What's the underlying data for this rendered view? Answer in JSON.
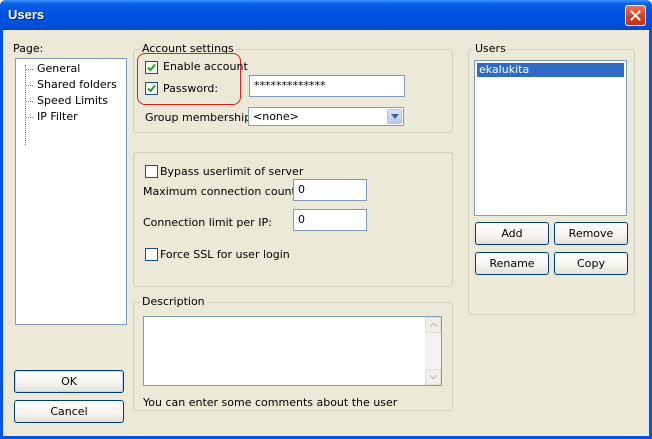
{
  "window": {
    "title": "Users",
    "close_icon": "close-icon"
  },
  "page_panel": {
    "label": "Page:",
    "items": [
      "General",
      "Shared folders",
      "Speed Limits",
      "IP Filter"
    ]
  },
  "account_settings": {
    "title": "Account settings",
    "enable_account": {
      "label": "Enable account",
      "checked": true
    },
    "password": {
      "label": "Password:",
      "checked": true,
      "value": "*************"
    },
    "group_membership": {
      "label": "Group membership:",
      "value": "<none>"
    }
  },
  "limits": {
    "bypass": {
      "label": "Bypass userlimit of server",
      "checked": false
    },
    "max_conn": {
      "label": "Maximum connection count:",
      "value": "0"
    },
    "conn_per_ip": {
      "label": "Connection limit per IP:",
      "value": "0"
    },
    "force_ssl": {
      "label": "Force SSL for user login",
      "checked": false
    }
  },
  "description": {
    "title": "Description",
    "value": "",
    "hint": "You can enter some comments about the user"
  },
  "users_panel": {
    "title": "Users",
    "items": [
      "ekalukita"
    ],
    "selected": "ekalukita",
    "add_label": "Add",
    "remove_label": "Remove",
    "rename_label": "Rename",
    "copy_label": "Copy"
  },
  "footer": {
    "ok_label": "OK",
    "cancel_label": "Cancel"
  },
  "colors": {
    "titlebar": "#0054e3",
    "face": "#ece9d8",
    "selection": "#316ac5",
    "annotation": "#e0201c"
  }
}
